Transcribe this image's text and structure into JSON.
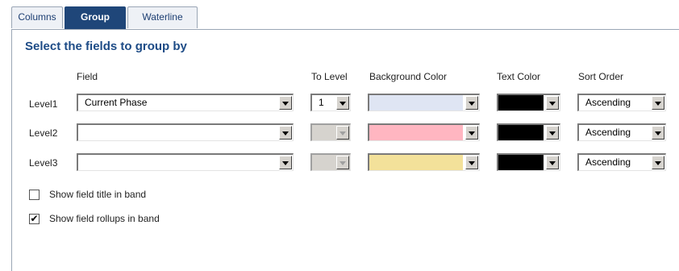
{
  "tabs": [
    {
      "label": "Columns",
      "active": false
    },
    {
      "label": "Group",
      "active": true
    },
    {
      "label": "Waterline",
      "active": false
    }
  ],
  "title": "Select the fields to group by",
  "headers": {
    "field": "Field",
    "to_level": "To Level",
    "background_color": "Background Color",
    "text_color": "Text Color",
    "sort_order": "Sort Order"
  },
  "rows": [
    {
      "label": "Level1",
      "field": "Current Phase",
      "to_level": "1",
      "to_level_enabled": true,
      "background_color": "#dfe5f3",
      "text_color": "#000000",
      "sort_order": "Ascending"
    },
    {
      "label": "Level2",
      "field": "",
      "to_level": "",
      "to_level_enabled": false,
      "background_color": "#ffb6c1",
      "text_color": "#000000",
      "sort_order": "Ascending"
    },
    {
      "label": "Level3",
      "field": "",
      "to_level": "",
      "to_level_enabled": false,
      "background_color": "#f3e19a",
      "text_color": "#000000",
      "sort_order": "Ascending"
    }
  ],
  "options": {
    "show_title": {
      "label": "Show  field title in band",
      "checked": false
    },
    "show_rollups": {
      "label": "Show  field rollups in band",
      "checked": true
    }
  },
  "icons": {
    "dropdown": "chevron-down-icon",
    "check": "check-icon"
  }
}
